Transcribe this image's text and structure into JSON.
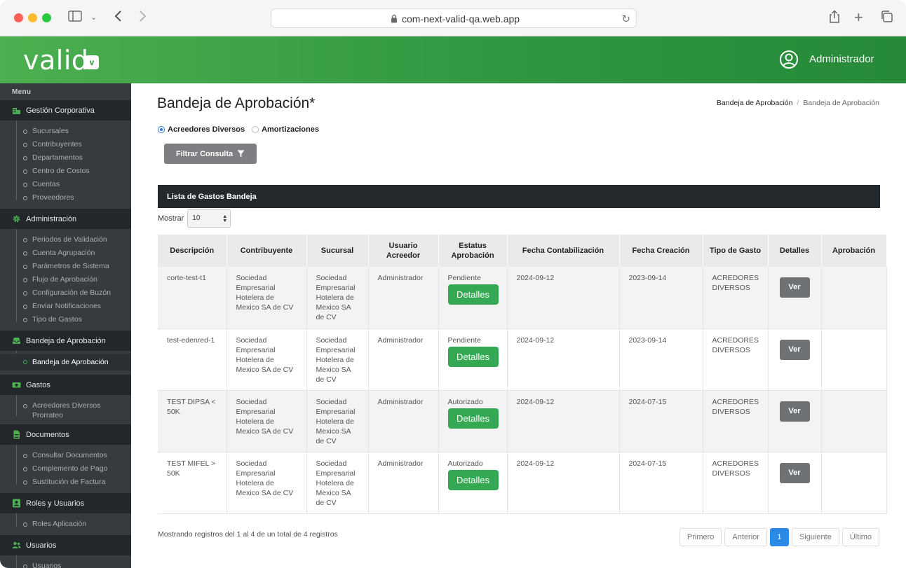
{
  "browser": {
    "url": "com-next-valid-qa.web.app"
  },
  "header": {
    "logo_text": "valid",
    "logo_badge": "v",
    "user_name": "Administrador"
  },
  "sidebar": {
    "menu_label": "Menu",
    "sections": [
      {
        "label": "Gestión Corporativa",
        "icon": "building-icon",
        "items": [
          "Sucursales",
          "Contribuyentes",
          "Departamentos",
          "Centro de Costos",
          "Cuentas",
          "Proveedores"
        ]
      },
      {
        "label": "Administración",
        "icon": "gear-icon",
        "items": [
          "Periodos de Validación",
          "Cuenta Agrupación",
          "Parámetros de Sistema",
          "Flujo de Aprobación",
          "Configuración de Buzón",
          "Enviar Notificaciones",
          "Tipo de Gastos"
        ]
      },
      {
        "label": "Bandeja de Aprobación",
        "icon": "inbox-icon",
        "items": [
          "Bandeja de Aprobación"
        ]
      },
      {
        "label": "Gastos",
        "icon": "money-icon",
        "items": [
          "Acreedores Diversos Prorrateo"
        ]
      },
      {
        "label": "Documentos",
        "icon": "document-icon",
        "items": [
          "Consultar Documentos",
          "Complemento de Pago",
          "Sustitución de Factura"
        ]
      },
      {
        "label": "Roles y Usuarios",
        "icon": "id-card-icon",
        "items": [
          "Roles Aplicación"
        ]
      },
      {
        "label": "Usuarios",
        "icon": "users-icon",
        "items": [
          "Usuarios"
        ]
      }
    ]
  },
  "page": {
    "title": "Bandeja de Aprobación*",
    "breadcrumb": [
      "Bandeja de Aprobación",
      "Bandeja de Aprobación"
    ],
    "radio_options": [
      {
        "label": "Acreedores Diversos",
        "selected": true
      },
      {
        "label": "Amortizaciones",
        "selected": false
      }
    ],
    "filter_button": "Filtrar Consulta",
    "panel_title": "Lista de Gastos Bandeja",
    "show_label": "Mostrar",
    "show_value": "10"
  },
  "table": {
    "columns": [
      "Descripción",
      "Contribuyente",
      "Sucursal",
      "Usuario Acreedor",
      "Estatus Aprobación",
      "Fecha Contabilización",
      "Fecha Creación",
      "Tipo de Gasto",
      "Detalles",
      "Aprobación"
    ],
    "detalles_label": "Detalles",
    "ver_label": "Ver",
    "rows": [
      {
        "descripcion": "corte-test-t1",
        "contribuyente": "Sociedad Empresarial Hotelera de Mexico SA de CV",
        "sucursal": "Sociedad Empresarial Hotelera de Mexico SA de CV",
        "usuario": "Administrador",
        "estatus": "Pendiente",
        "fecha_contabilizacion": "2024-09-12",
        "fecha_creacion": "2023-09-14",
        "tipo_gasto": "ACREDORES DIVERSOS"
      },
      {
        "descripcion": "test-edenred-1",
        "contribuyente": "Sociedad Empresarial Hotelera de Mexico SA de CV",
        "sucursal": "Sociedad Empresarial Hotelera de Mexico SA de CV",
        "usuario": "Administrador",
        "estatus": "Pendiente",
        "fecha_contabilizacion": "2024-09-12",
        "fecha_creacion": "2023-09-14",
        "tipo_gasto": "ACREDORES DIVERSOS"
      },
      {
        "descripcion": "TEST DIPSA < 50K",
        "contribuyente": "Sociedad Empresarial Hotelera de Mexico SA de CV",
        "sucursal": "Sociedad Empresarial Hotelera de Mexico SA de CV",
        "usuario": "Administrador",
        "estatus": "Autorizado",
        "fecha_contabilizacion": "2024-09-12",
        "fecha_creacion": "2024-07-15",
        "tipo_gasto": "ACREDORES DIVERSOS"
      },
      {
        "descripcion": "TEST MIFEL > 50K",
        "contribuyente": "Sociedad Empresarial Hotelera de Mexico SA de CV",
        "sucursal": "Sociedad Empresarial Hotelera de Mexico SA de CV",
        "usuario": "Administrador",
        "estatus": "Autorizado",
        "fecha_contabilizacion": "2024-09-12",
        "fecha_creacion": "2024-07-15",
        "tipo_gasto": "ACREDORES DIVERSOS"
      }
    ]
  },
  "footer": {
    "info": "Mostrando registros del 1 al 4 de un total de 4 registros",
    "pager": {
      "first": "Primero",
      "prev": "Anterior",
      "current": "1",
      "next": "Siguiente",
      "last": "Último"
    }
  },
  "colors": {
    "brand_green": "#2e9540",
    "detalles_green": "#34a853",
    "sidebar_bg": "#363b40",
    "panel_dark": "#24292e",
    "page_active": "#2b8ae6"
  }
}
